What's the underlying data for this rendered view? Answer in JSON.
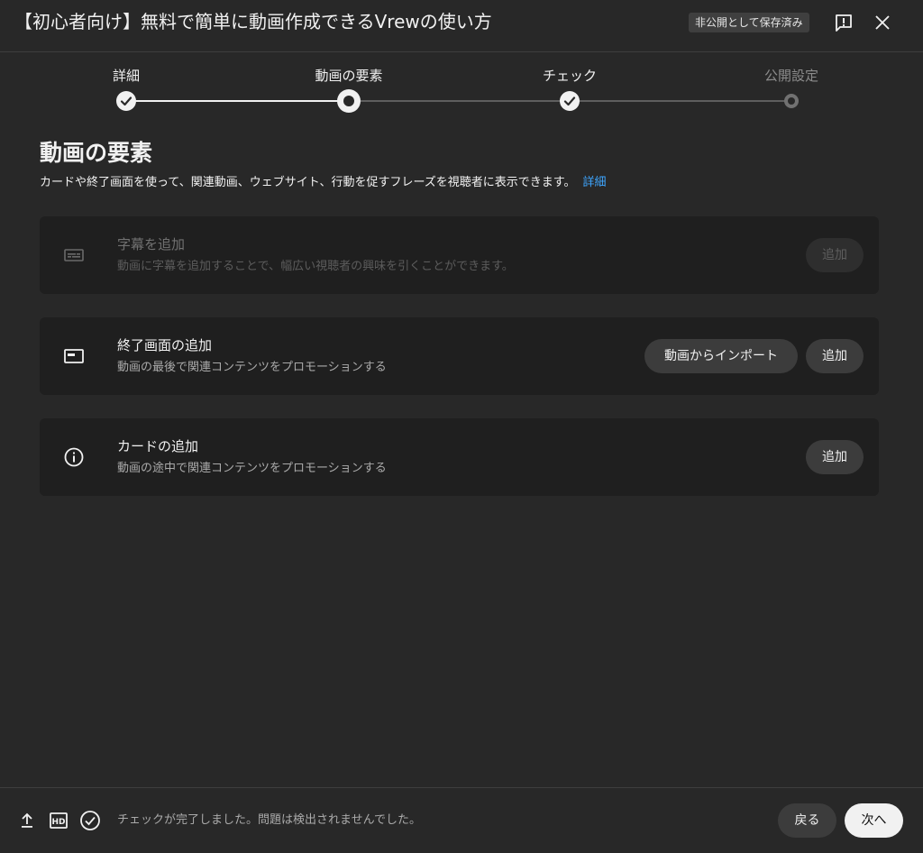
{
  "header": {
    "title": "【初心者向け】無料で簡単に動画作成できるVrewの使い方",
    "saved_badge": "非公開として保存済み",
    "feedback_icon": "feedback-icon",
    "close_icon": "close-icon"
  },
  "stepper": {
    "steps": [
      {
        "label": "詳細",
        "state": "done"
      },
      {
        "label": "動画の要素",
        "state": "current"
      },
      {
        "label": "チェック",
        "state": "done"
      },
      {
        "label": "公開設定",
        "state": "pending"
      }
    ]
  },
  "section": {
    "title": "動画の要素",
    "description": "カードや終了画面を使って、関連動画、ウェブサイト、行動を促すフレーズを視聴者に表示できます。",
    "link": "詳細"
  },
  "cards": [
    {
      "icon": "subtitles-icon",
      "title": "字幕を追加",
      "subtitle": "動画に字幕を追加することで、幅広い視聴者の興味を引くことができます。",
      "add_label": "追加",
      "enabled": false
    },
    {
      "icon": "end-screen-icon",
      "title": "終了画面の追加",
      "subtitle": "動画の最後で関連コンテンツをプロモーションする",
      "import_label": "動画からインポート",
      "add_label": "追加",
      "enabled": true
    },
    {
      "icon": "info-icon",
      "title": "カードの追加",
      "subtitle": "動画の途中で関連コンテンツをプロモーションする",
      "add_label": "追加",
      "enabled": true
    }
  ],
  "footer": {
    "icons": [
      "upload-icon",
      "hd-icon",
      "check-circle-icon"
    ],
    "status": "チェックが完了しました。問題は検出されませんでした。",
    "back_label": "戻る",
    "next_label": "次へ"
  },
  "colors": {
    "background": "#282828",
    "card": "#1f1f1f",
    "accent_link": "#3ea6ff",
    "text": "#f1f1f1"
  }
}
